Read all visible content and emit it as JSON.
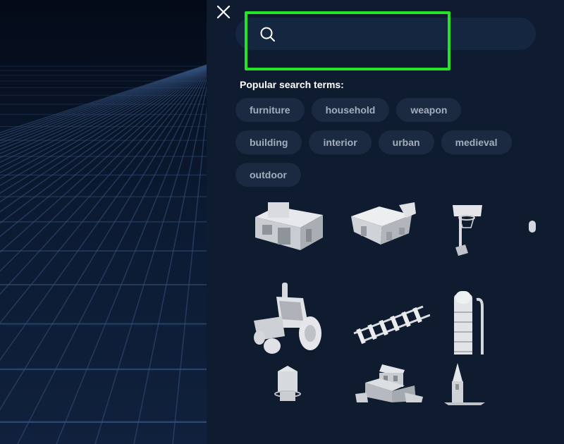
{
  "close_button": {
    "icon": "close-icon"
  },
  "search": {
    "value": "",
    "placeholder": "",
    "icon": "search-icon",
    "highlight_color": "#27e327"
  },
  "popular": {
    "label": "Popular search terms:",
    "terms": [
      "furniture",
      "household",
      "weapon",
      "building",
      "interior",
      "urban",
      "medieval",
      "outdoor"
    ]
  },
  "results": [
    {
      "icon": "modern-house-model-icon"
    },
    {
      "icon": "barn-model-icon"
    },
    {
      "icon": "basketball-hoop-model-icon"
    },
    {
      "icon": "tractor-model-icon"
    },
    {
      "icon": "railroad-track-model-icon"
    },
    {
      "icon": "ladder-tower-model-icon"
    },
    {
      "icon": "water-tower-model-icon"
    },
    {
      "icon": "mansion-model-icon"
    },
    {
      "icon": "church-spire-model-icon"
    }
  ],
  "colors": {
    "panel_bg": "#0f1c30",
    "chip_bg": "#1b2a40",
    "chip_text": "#a3adbd",
    "grid_line": "#33517c"
  }
}
